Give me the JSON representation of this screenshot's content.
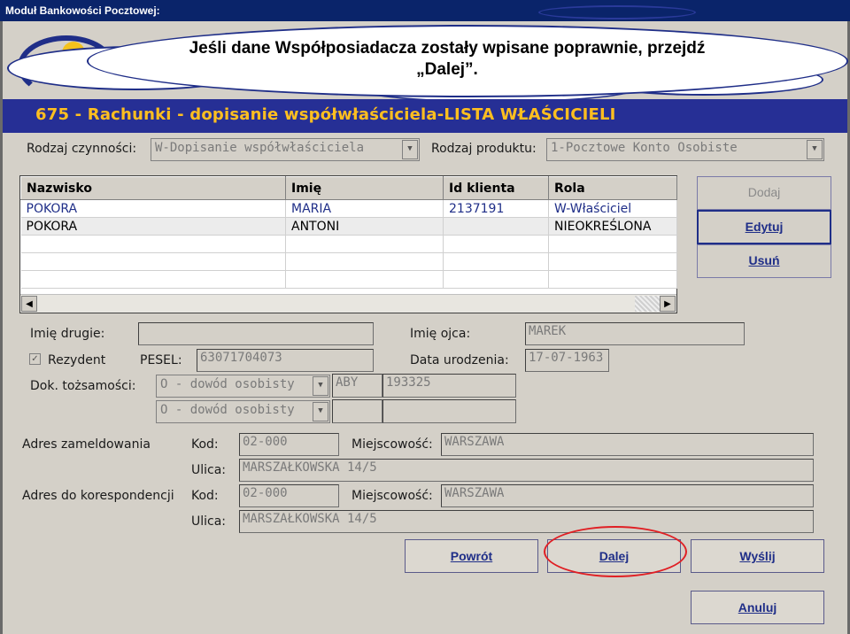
{
  "window": {
    "title": "Moduł Bankowości Pocztowej:"
  },
  "callout": {
    "line1": "Jeśli dane Współposiadacza zostały wpisane poprawnie, przejdź",
    "line2": "„Dalej”."
  },
  "header": {
    "title": "675 - Rachunki - dopisanie współwłaściciela-LISTA WŁAŚCICIELI"
  },
  "top_fields": {
    "rodzaj_czynnosci_label": "Rodzaj czynności:",
    "rodzaj_czynnosci_value": "W-Dopisanie współwłaściciela",
    "rodzaj_produktu_label": "Rodzaj produktu:",
    "rodzaj_produktu_value": "1-Pocztowe Konto Osobiste"
  },
  "table": {
    "columns": [
      "Nazwisko",
      "Imię",
      "Id klienta",
      "Rola"
    ],
    "rows": [
      [
        "POKORA",
        "MARIA",
        "2137191",
        "W-Właściciel"
      ],
      [
        "POKORA",
        "ANTONI",
        "",
        "NIEOKREŚLONA"
      ]
    ]
  },
  "side_buttons": {
    "add": "Dodaj",
    "edit": "Edytuj",
    "delete": "Usuń"
  },
  "person": {
    "imie_drugie_label": "Imię drugie:",
    "imie_drugie_value": "",
    "imie_ojca_label": "Imię ojca:",
    "imie_ojca_value": "MAREK",
    "rezydent_label": "Rezydent",
    "rezydent_checked": true,
    "pesel_label": "PESEL:",
    "pesel_value": "63071704073",
    "data_ur_label": "Data urodzenia:",
    "data_ur_value": "17-07-1963",
    "dok_label": "Dok. tożsamości:",
    "dok1_type": "O - dowód osobisty",
    "dok1_series": "ABY",
    "dok1_number": "193325",
    "dok2_type": "O - dowód osobisty",
    "dok2_series": "",
    "dok2_number": ""
  },
  "address": {
    "zameldowania_label": "Adres zameldowania",
    "korespondencji_label": "Adres do korespondencji",
    "kod_label": "Kod:",
    "miejscowosc_label": "Miejscowość:",
    "ulica_label": "Ulica:",
    "z_kod": "02-000",
    "z_miejscowosc": "WARSZAWA",
    "z_ulica": "MARSZAŁKOWSKA 14/5",
    "k_kod": "02-000",
    "k_miejscowosc": "WARSZAWA",
    "k_ulica": "MARSZAŁKOWSKA 14/5"
  },
  "bottom_buttons": {
    "back": "Powrót",
    "next": "Dalej",
    "send": "Wyślij",
    "cancel": "Anuluj"
  },
  "colors": {
    "header_bg": "#262f95",
    "header_fg": "#ffbf1f",
    "highlight": "#e01f24",
    "titlebar": "#0a246a"
  }
}
